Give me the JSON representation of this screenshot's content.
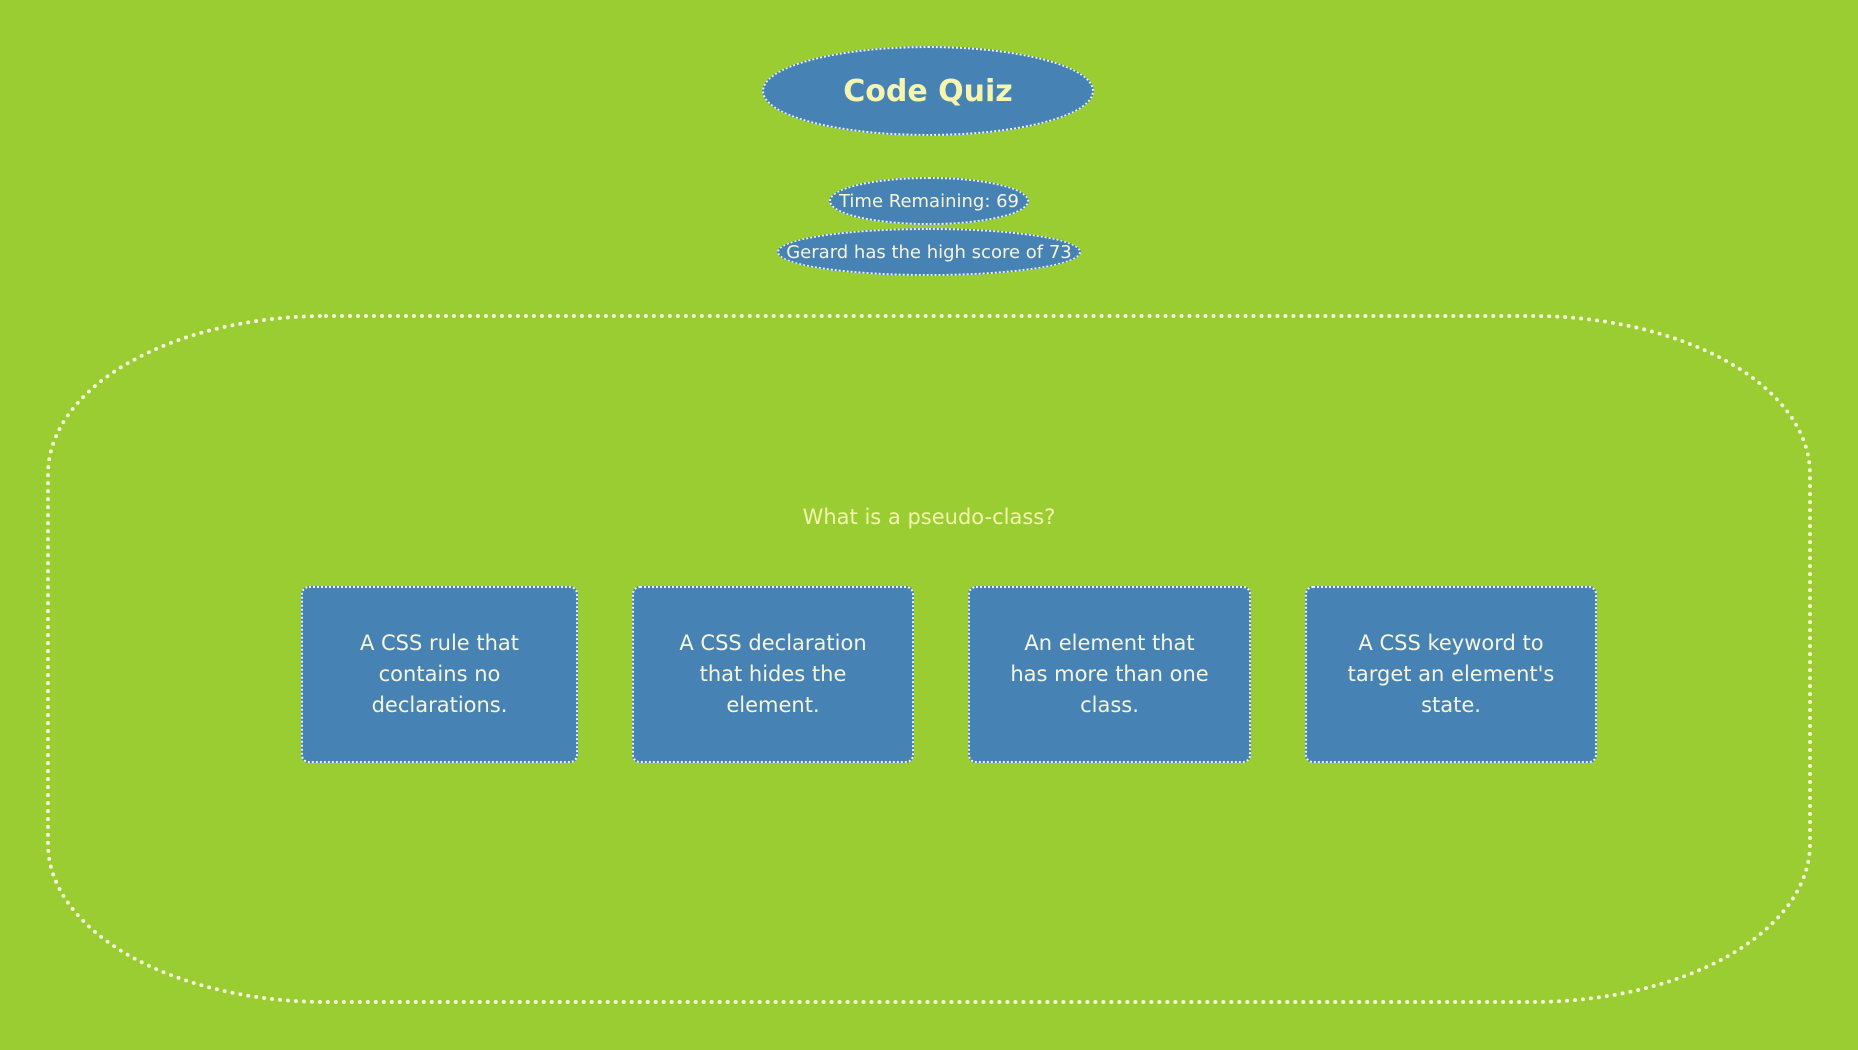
{
  "header": {
    "title": "Code Quiz",
    "timer_text": "Time Remaining: 69",
    "high_score_text": "Gerard has the high score of 73"
  },
  "quiz": {
    "question": "What is a pseudo-class?",
    "answers": [
      {
        "label": "A CSS rule that contains no declarations."
      },
      {
        "label": "A CSS declaration that hides the element."
      },
      {
        "label": "An element that has more than one class."
      },
      {
        "label": "A CSS keyword to target an element's state."
      }
    ]
  },
  "colors": {
    "background": "#9ACD32",
    "accent": "#4682B4",
    "text": "#F5F5DC"
  }
}
